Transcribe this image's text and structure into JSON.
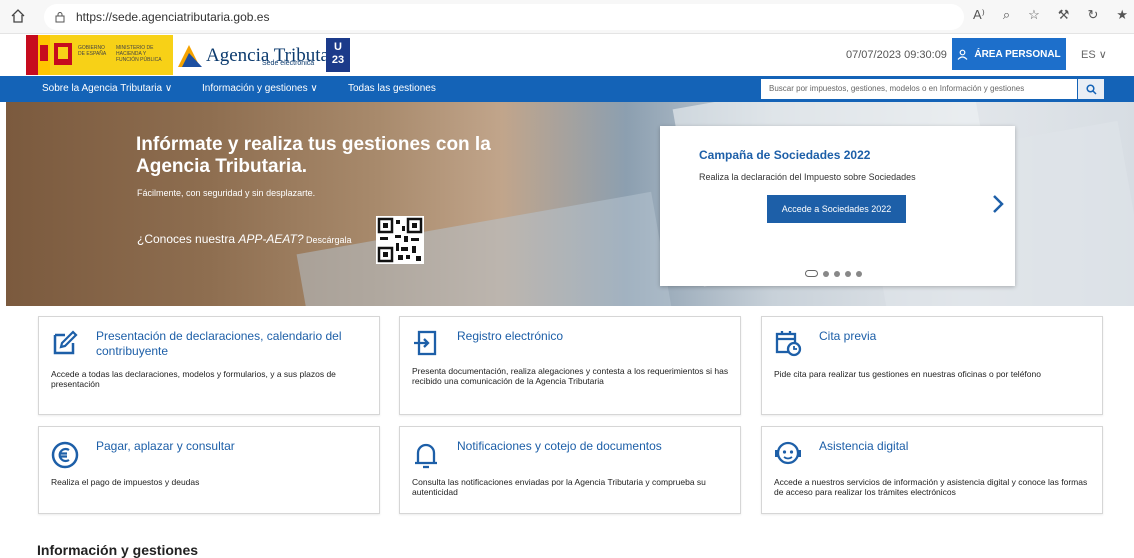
{
  "browser": {
    "url": "https://sede.agenciatributaria.gob.es",
    "home_icon": "home-icon",
    "toolbar_icons": [
      "read-aloud-icon",
      "zoom-icon",
      "favorite-add-icon",
      "extensions-icon",
      "collections-icon",
      "favorites-icon"
    ],
    "toolbar_glyphs": [
      "A⁾",
      "⌕",
      "☆",
      "⚒",
      "↻",
      "★"
    ]
  },
  "header": {
    "gov_logo_lines": [
      "GOBIERNO DE ESPAÑA",
      "MINISTERIO DE HACIENDA Y FUNCIÓN PÚBLICA"
    ],
    "brand": "Agencia Tributaria",
    "brand_sub": "Sede electrónica",
    "u23": [
      "U",
      "23"
    ],
    "datetime": "07/07/2023 09:30:09",
    "area_personal": "ÁREA PERSONAL",
    "lang": "ES ∨"
  },
  "nav": {
    "items": [
      "Sobre la Agencia Tributaria ∨",
      "Información y gestiones ∨",
      "Todas las gestiones"
    ],
    "search_placeholder": "Buscar por impuestos, gestiones, modelos o en Información y gestiones"
  },
  "hero": {
    "title": "Infórmate y realiza tus gestiones con la Agencia Tributaria.",
    "subtitle": "Fácilmente, con seguridad y sin desplazarte.",
    "app_prefix": "¿Conoces nuestra ",
    "app_name": "APP-AEAT?",
    "app_suffix": " Descárgala"
  },
  "promo": {
    "title": "Campaña de Sociedades 2022",
    "description": "Realiza la declaración del Impuesto sobre Sociedades",
    "button": "Accede a Sociedades 2022",
    "active_slide": 1,
    "slide_count": 5
  },
  "cards": [
    {
      "title": "Presentación de declaraciones, calendario del contribuyente",
      "desc": "Accede a todas las declaraciones, modelos y formularios, y a sus plazos de presentación",
      "icon": "edit-form-icon"
    },
    {
      "title": "Registro electrónico",
      "desc": "Presenta documentación, realiza alegaciones y contesta a los requerimientos si has recibido una comunicación de la Agencia Tributaria",
      "icon": "login-register-icon"
    },
    {
      "title": "Cita previa",
      "desc": "Pide cita para realizar tus gestiones en nuestras oficinas o por teléfono",
      "icon": "calendar-clock-icon"
    },
    {
      "title": "Pagar, aplazar y consultar",
      "desc": "Realiza el pago de impuestos y deudas",
      "icon": "euro-icon"
    },
    {
      "title": "Notificaciones y cotejo de documentos",
      "desc": "Consulta las notificaciones enviadas por la Agencia Tributaria y comprueba su autenticidad",
      "icon": "bell-icon"
    },
    {
      "title": "Asistencia digital",
      "desc": "Accede a nuestros servicios de información y asistencia digital y conoce las formas de acceso para realizar los trámites electrónicos",
      "icon": "support-agent-icon"
    }
  ],
  "section_title": "Información y gestiones",
  "colors": {
    "primary": "#1463b7",
    "link": "#1d5fa8",
    "button": "#1d6fcb"
  }
}
